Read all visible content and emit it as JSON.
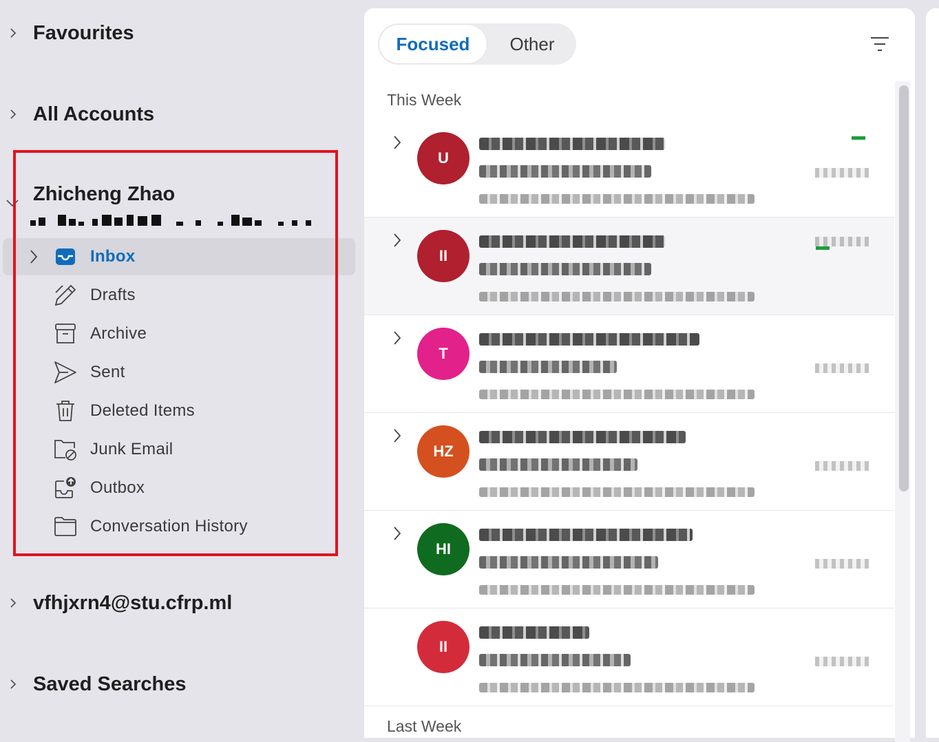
{
  "sidebar": {
    "favourites": "Favourites",
    "all_accounts": "All Accounts",
    "account": {
      "name": "Zhicheng Zhao",
      "folders": [
        {
          "label": "Inbox",
          "icon": "inbox-icon",
          "selected": true
        },
        {
          "label": "Drafts",
          "icon": "drafts-icon"
        },
        {
          "label": "Archive",
          "icon": "archive-icon"
        },
        {
          "label": "Sent",
          "icon": "sent-icon"
        },
        {
          "label": "Deleted Items",
          "icon": "trash-icon"
        },
        {
          "label": "Junk Email",
          "icon": "junk-icon"
        },
        {
          "label": "Outbox",
          "icon": "outbox-icon"
        },
        {
          "label": "Conversation History",
          "icon": "folder-icon"
        }
      ]
    },
    "second_account": "vfhjxrn4@stu.cfrp.ml",
    "saved_searches": "Saved Searches"
  },
  "message_list": {
    "tabs": {
      "focused": "Focused",
      "other": "Other"
    },
    "groups": {
      "this_week": "This Week",
      "last_week": "Last Week"
    },
    "messages": [
      {
        "avatar_color": "#b0202e",
        "initials": "U"
      },
      {
        "avatar_color": "#b0202e",
        "initials": "II"
      },
      {
        "avatar_color": "#e3218a",
        "initials": "T"
      },
      {
        "avatar_color": "#d4501e",
        "initials": "HZ"
      },
      {
        "avatar_color": "#0f6b1f",
        "initials": "HI"
      },
      {
        "avatar_color": "#d42b3a",
        "initials": "II"
      }
    ]
  },
  "colors": {
    "accent": "#0f6cbd",
    "highlight": "#e0141f"
  }
}
